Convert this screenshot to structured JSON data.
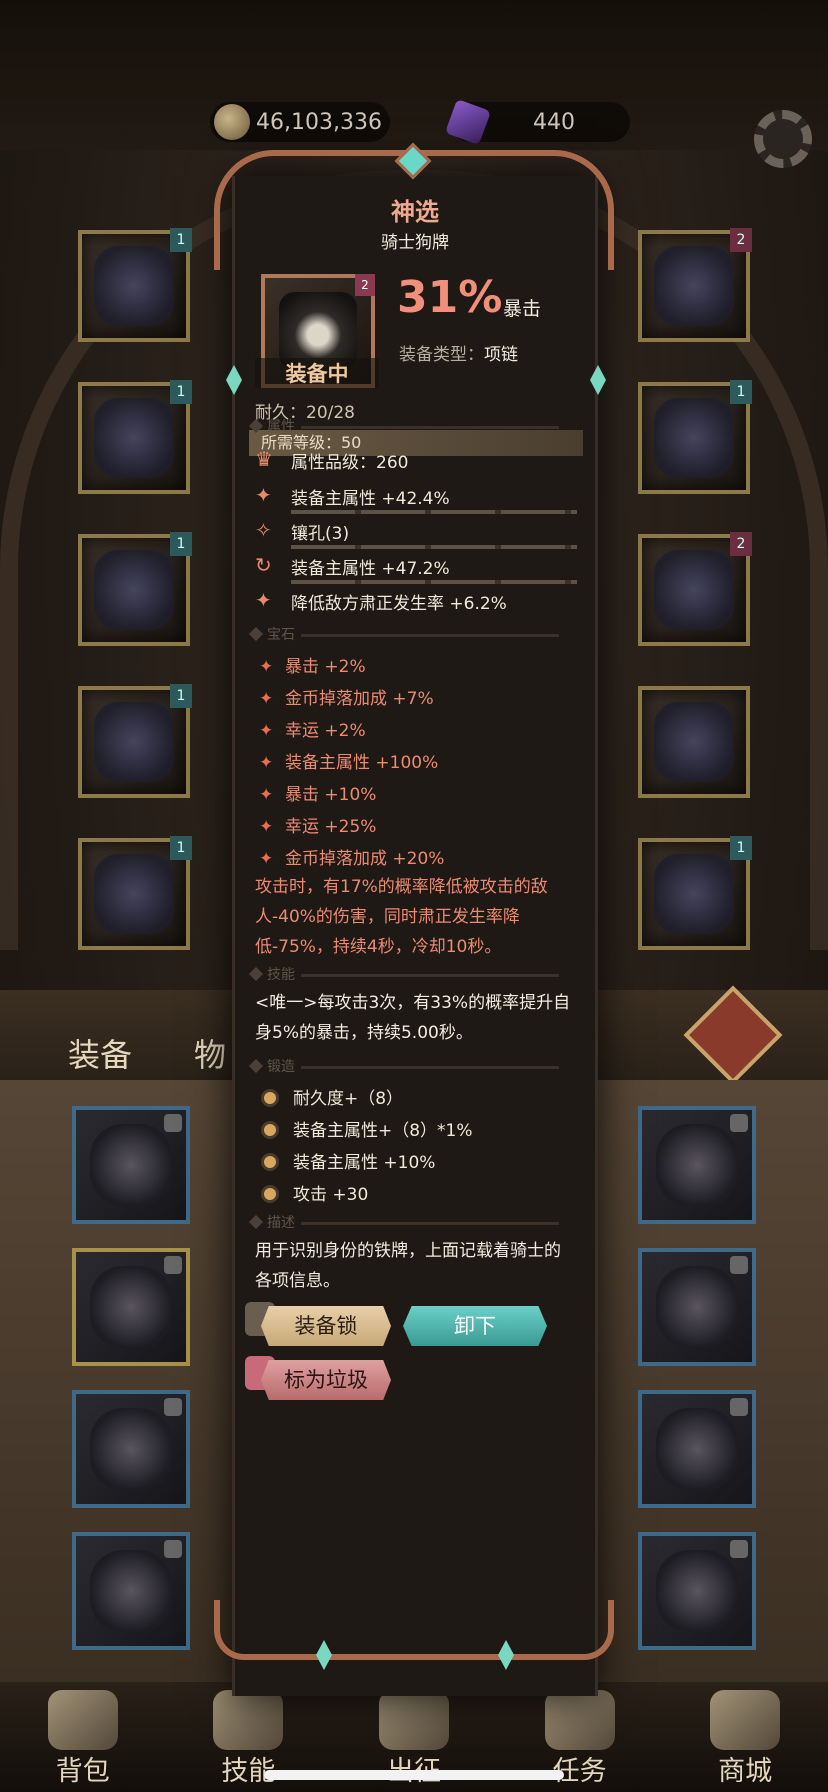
{
  "resources": {
    "gold": "46,103,336",
    "gems": "440"
  },
  "mid_tabs": {
    "equip": "装备",
    "items": "物"
  },
  "nav": [
    "背包",
    "技能",
    "出征",
    "任务",
    "商城"
  ],
  "slots_left_levels": [
    "1",
    "1",
    "1",
    "1",
    "1"
  ],
  "slots_right_levels": [
    "2",
    "1",
    "2",
    "",
    "1"
  ],
  "item": {
    "quality": "神选",
    "name": "骑士狗牌",
    "star": "2",
    "equipped_label": "装备中",
    "crit_value": "31%",
    "crit_label": "暴击",
    "type_label": "装备类型：",
    "type_value": "项链",
    "durability": "耐久：20/28",
    "required_level": "所需等级：50"
  },
  "sections": {
    "attributes": "属性",
    "gems": "宝石",
    "skills": "技能",
    "forge": "锻造",
    "description": "描述"
  },
  "attributes": [
    {
      "icon": "quality-icon",
      "text": "属性品级：260"
    },
    {
      "icon": "sparkle-icon",
      "text": "装备主属性 +42.4%"
    },
    {
      "icon": "socket-icon",
      "text": "镶孔(3)"
    },
    {
      "icon": "cycle-icon",
      "text": "装备主属性 +47.2%"
    },
    {
      "icon": "sparkle-icon",
      "text": "降低敌方肃正发生率 +6.2%"
    }
  ],
  "gem_bonuses": [
    "暴击 +2%",
    "金币掉落加成 +7%",
    "幸运 +2%",
    "装备主属性 +100%",
    "暴击 +10%",
    "幸运 +25%",
    "金币掉落加成 +20%"
  ],
  "set_effect": "攻击时，有17%的概率降低被攻击的敌人-40%的伤害，同时肃正发生率降低-75%，持续4秒，冷却10秒。",
  "skill": "<唯一>每攻击3次，有33%的概率提升自身5%的暴击，持续5.00秒。",
  "forge_bonuses": [
    "耐久度+（8）",
    "装备主属性+（8）*1%",
    "装备主属性 +10%",
    "攻击 +30"
  ],
  "description": "用于识别身份的铁牌，上面记载着骑士的各项信息。",
  "buttons": {
    "lock": "装备锁",
    "unequip": "卸下",
    "mark_trash": "标为垃圾"
  },
  "colors": {
    "quality_title": "#f0a890",
    "crit": "#f0907a",
    "gem_text": "#ec8a72",
    "unequip_btn": "#3a9a94"
  }
}
